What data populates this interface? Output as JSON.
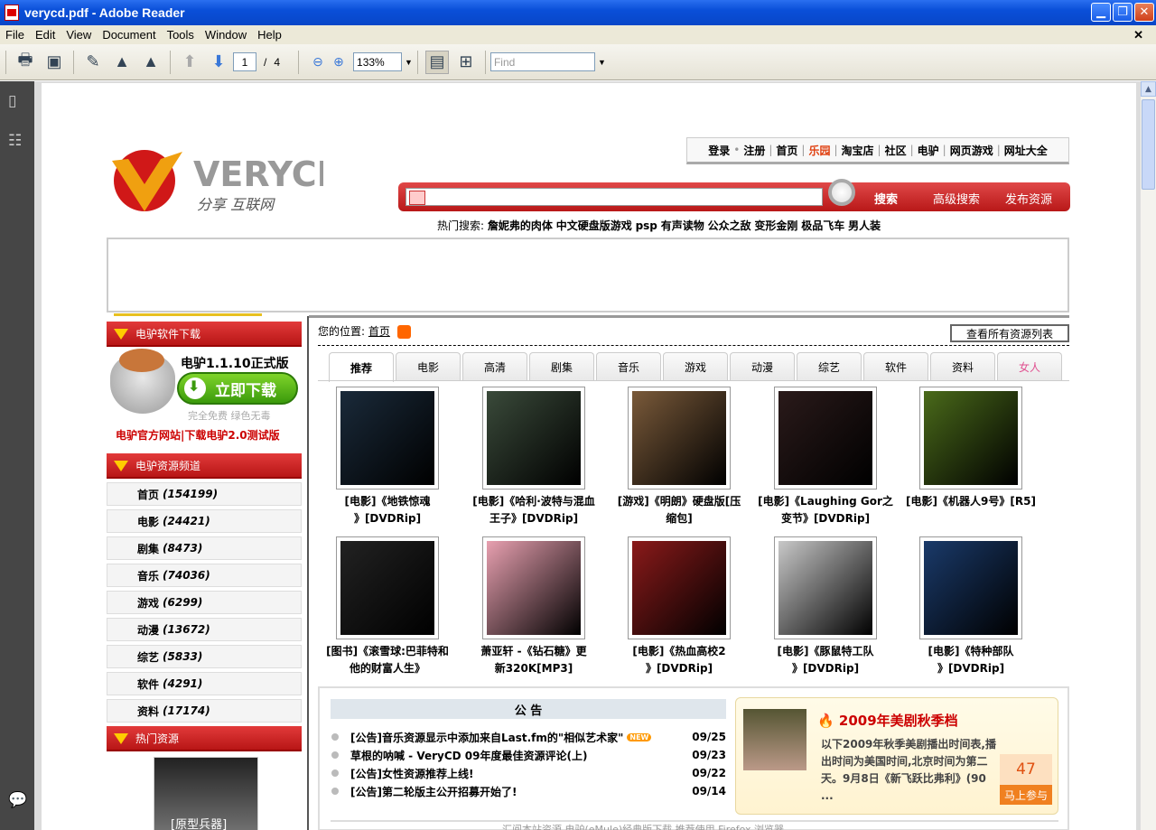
{
  "window": {
    "title": "verycd.pdf - Adobe Reader"
  },
  "menu": [
    "File",
    "Edit",
    "View",
    "Document",
    "Tools",
    "Window",
    "Help"
  ],
  "toolbar": {
    "page_current": "1",
    "page_sep": "/",
    "page_total": "4",
    "zoom": "133%",
    "find_placeholder": "Find"
  },
  "site": {
    "logo_text": "VERYCD",
    "logo_sub": "分享 互联网",
    "topnav": [
      "登录",
      "注册",
      "首页",
      "乐园",
      "淘宝店",
      "社区",
      "电驴",
      "网页游戏",
      "网址大全"
    ],
    "search_buttons": [
      "搜索",
      "高级搜索",
      "发布资源"
    ],
    "hot_label": "热门搜索:",
    "hot_items": [
      "詹妮弗的肉体",
      "中文硬盘版游戏",
      "psp",
      "有声读物",
      "公众之敌",
      "变形金刚",
      "极品飞车",
      "男人装"
    ]
  },
  "left": {
    "head1": "电驴软件下载",
    "emule_title": "电驴1.1.10正式版",
    "download_btn": "立即下载",
    "download_sub": "完全免费 绿色无毒",
    "emule_links": "电驴官方网站|下载电驴2.0测试版",
    "head2": "电驴资源频道",
    "channels": [
      {
        "name": "首页",
        "count": "(154199)"
      },
      {
        "name": "电影",
        "count": "(24421)"
      },
      {
        "name": "剧集",
        "count": "(8473)"
      },
      {
        "name": "音乐",
        "count": "(74036)"
      },
      {
        "name": "游戏",
        "count": "(6299)"
      },
      {
        "name": "动漫",
        "count": "(13672)"
      },
      {
        "name": "综艺",
        "count": "(5833)"
      },
      {
        "name": "软件",
        "count": "(4291)"
      },
      {
        "name": "资料",
        "count": "(17174)"
      }
    ],
    "head3": "热门资源",
    "hot_img_text": "[原型兵器]"
  },
  "main": {
    "loc_label": "您的位置:",
    "loc_link": "首页",
    "all_list": "查看所有资源列表",
    "tabs": [
      "推荐",
      "电影",
      "高清",
      "剧集",
      "音乐",
      "游戏",
      "动漫",
      "综艺",
      "软件",
      "资料",
      "女人"
    ],
    "items": [
      {
        "l1": "[电影]《地铁惊魂",
        "l2": "》[DVDRip]",
        "c": "#1a2a3a"
      },
      {
        "l1": "[电影]《哈利·波特与混血",
        "l2": "王子》[DVDRip]",
        "c": "#3a4a3a"
      },
      {
        "l1": "[游戏]《明朗》硬盘版[压",
        "l2": "缩包]",
        "c": "#7a5a3a"
      },
      {
        "l1": "[电影]《Laughing Gor之",
        "l2": "变节》[DVDRip]",
        "c": "#2a1a1a"
      },
      {
        "l1": "[电影]《机器人9号》[R5]",
        "l2": "",
        "c": "#4a6a1a"
      },
      {
        "l1": "[图书]《滚雪球:巴菲特和",
        "l2": "他的财富人生》",
        "c": "#222222"
      },
      {
        "l1": "萧亚轩 -《钻石糖》更",
        "l2": "新320K[MP3]",
        "c": "#e8a0b0"
      },
      {
        "l1": "[电影]《热血高校2",
        "l2": "》[DVDRip]",
        "c": "#8a1a1a"
      },
      {
        "l1": "[电影]《豚鼠特工队",
        "l2": "》[DVDRip]",
        "c": "#c8c8c8"
      },
      {
        "l1": "[电影]《特种部队",
        "l2": "》[DVDRip]",
        "c": "#1a3a6a"
      }
    ],
    "notice_title": "公 告",
    "notices": [
      {
        "t": "[公告]音乐资源显示中添加来自Last.fm的\"相似艺术家\"",
        "d": "09/25",
        "new": "NEW"
      },
      {
        "t": "草根的呐喊 - VeryCD 09年度最佳资源评论(上)",
        "d": "09/23",
        "new": ""
      },
      {
        "t": "[公告]女性资源推荐上线!",
        "d": "09/22",
        "new": ""
      },
      {
        "t": "[公告]第二轮版主公开招募开始了!",
        "d": "09/14",
        "new": ""
      }
    ],
    "promo_title": "2009年美剧秋季档",
    "promo_text": "以下2009年秋季美剧播出时间表,播出时间为美国时间,北京时间为第二天。9月8日《新飞跃比弗利》(90 ...",
    "promo_count": "47",
    "promo_btn": "马上参与",
    "bottom_text": "汇阅本站资源 电驴(eMule)经典版下载 推荐使用 Firefox 浏览器"
  }
}
